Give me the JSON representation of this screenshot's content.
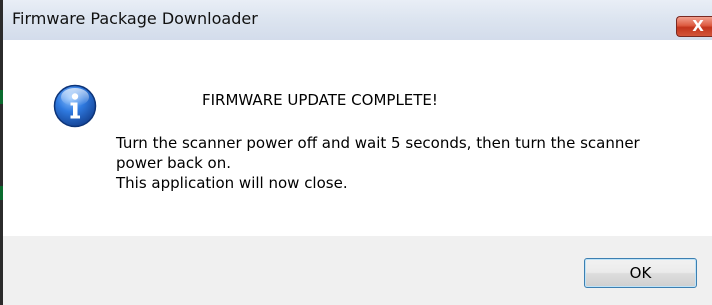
{
  "window": {
    "title": "Firmware Package Downloader",
    "close_glyph": "X",
    "close_icon": "close-icon"
  },
  "dialog": {
    "icon": "info-icon",
    "heading": "FIRMWARE UPDATE COMPLETE!",
    "message_lines": [
      "Turn the scanner power off and wait 5 seconds, then turn the scanner",
      "power back on.",
      "This application will now close."
    ]
  },
  "buttons": {
    "ok_label": "OK"
  },
  "colors": {
    "icon_blue": "#1e5fb8",
    "close_red": "#c9381e",
    "ok_border": "#3c7fb1"
  }
}
